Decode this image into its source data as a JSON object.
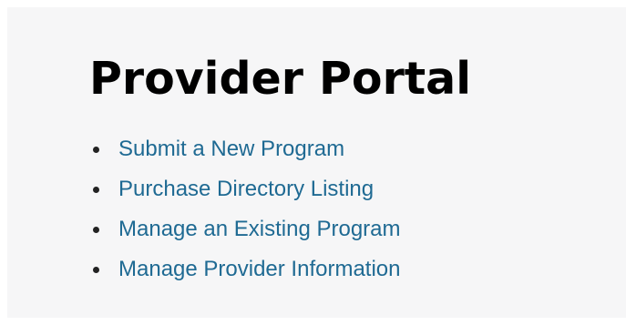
{
  "page": {
    "title": "Provider Portal"
  },
  "menu": {
    "items": [
      {
        "label": "Submit a New Program"
      },
      {
        "label": "Purchase Directory Listing"
      },
      {
        "label": "Manage an Existing Program"
      },
      {
        "label": "Manage Provider Information"
      }
    ]
  },
  "colors": {
    "background": "#f6f6f7",
    "link": "#1f6a93",
    "title": "#000000"
  }
}
